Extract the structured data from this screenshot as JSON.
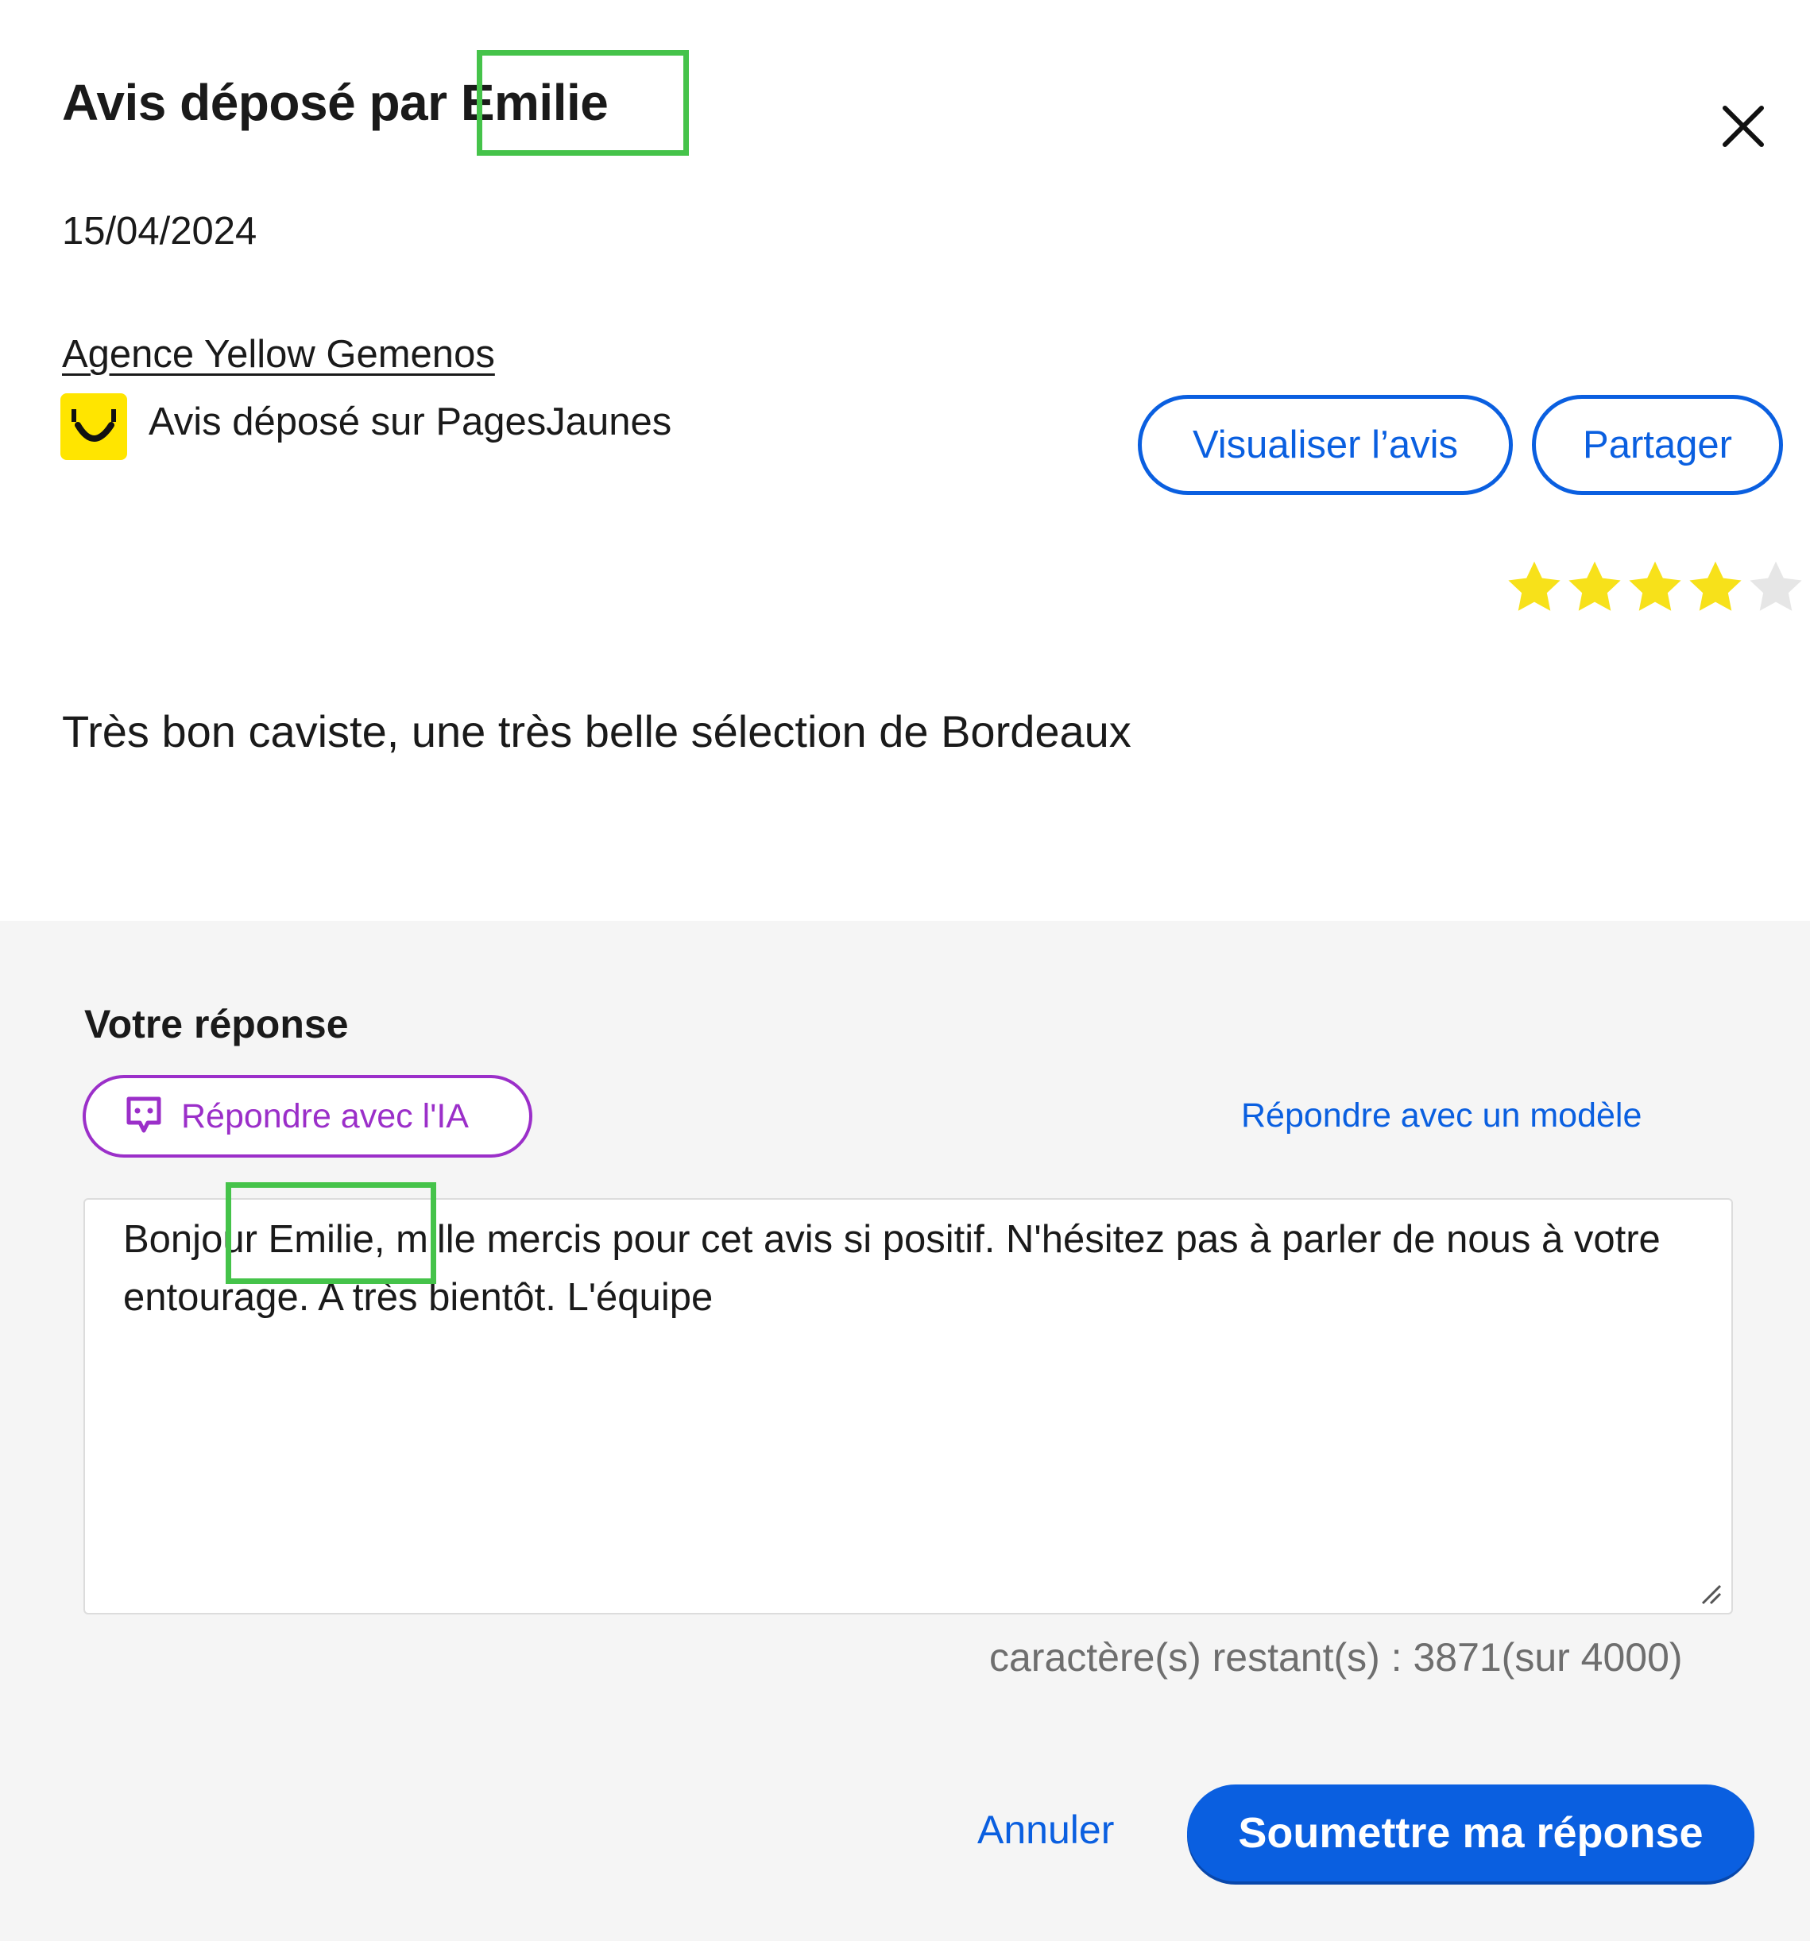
{
  "header": {
    "title": "Avis déposé par Emilie",
    "date": "15/04/2024",
    "close_icon": "close-icon"
  },
  "review": {
    "agency": "Agence Yellow Gemenos",
    "source": "Avis déposé sur PagesJaunes",
    "source_logo": "pagesjaunes-smile-logo",
    "rating": 4,
    "rating_max": 5,
    "text": "Très bon caviste, une très belle sélection de Bordeaux",
    "actions": {
      "view_label": "Visualiser l’avis",
      "share_label": "Partager"
    }
  },
  "response": {
    "title": "Votre réponse",
    "ai_button_label": "Répondre avec l'IA",
    "ai_icon": "chat-ai-icon",
    "template_link": "Répondre avec un modèle",
    "text": "Bonjour Emilie, mille mercis pour cet avis si positif. N'hésitez pas à parler de nous à votre entourage. A très bientôt. L'équipe",
    "counter": "caractère(s) restant(s) : 3871(sur 4000)"
  },
  "footer": {
    "cancel_label": "Annuler",
    "submit_label": "Soumettre ma réponse"
  },
  "colors": {
    "primary": "#0a5fe0",
    "ai_purple": "#9b2fc9",
    "star_filled": "#f7e11a",
    "star_empty": "#e6e6e6",
    "highlight": "#45c34a",
    "pj_yellow": "#ffe500"
  }
}
